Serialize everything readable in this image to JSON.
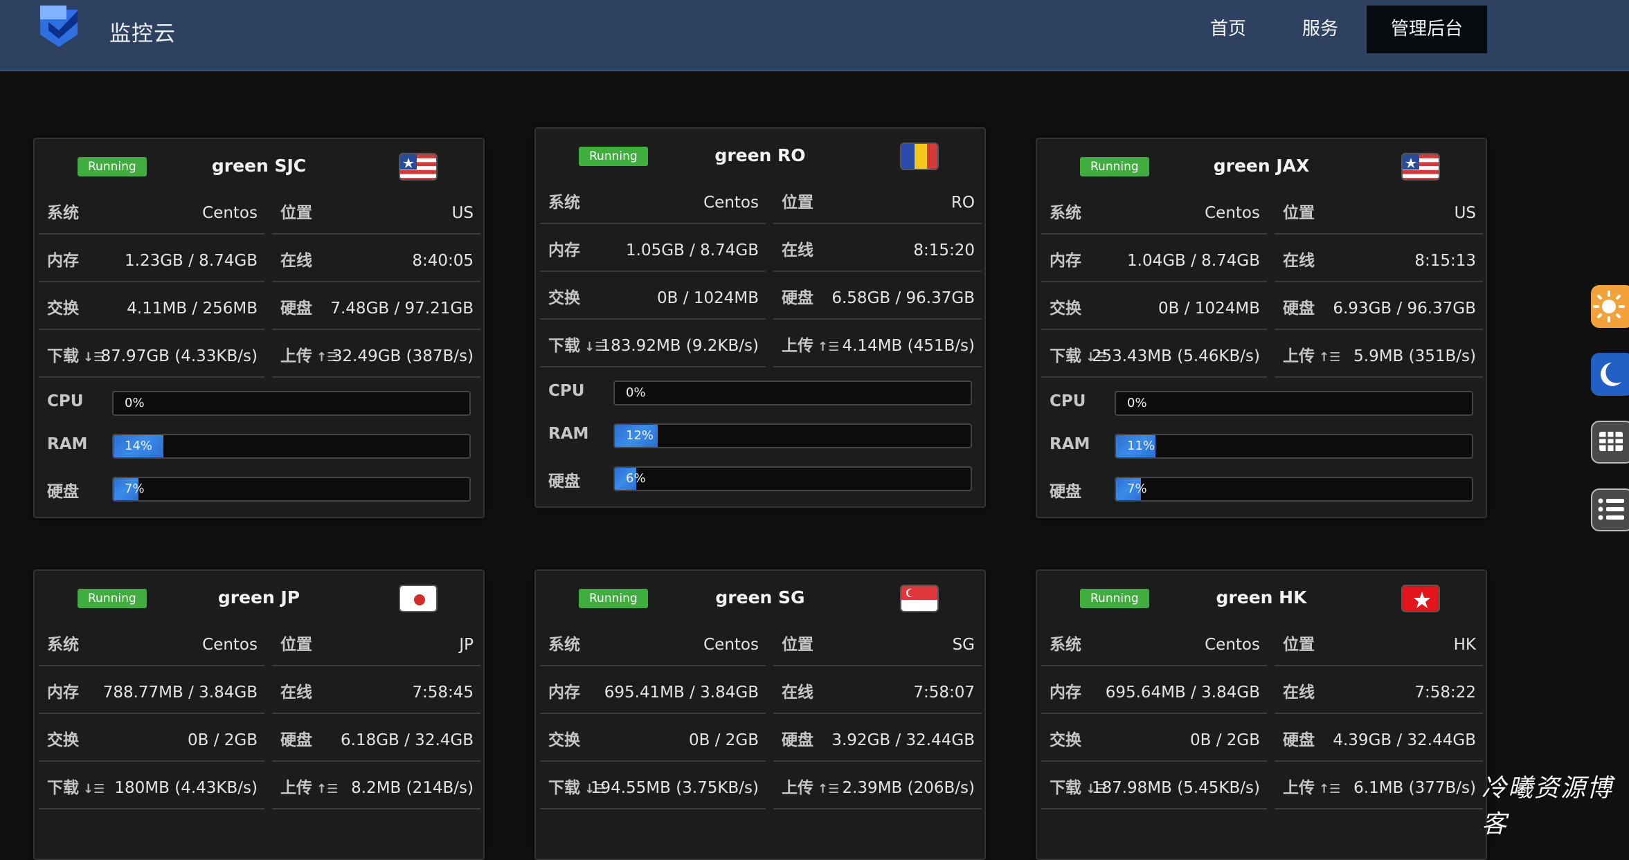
{
  "brand": {
    "name": "监控云",
    "logo_icon": "shield-logo-icon"
  },
  "nav": {
    "home": "首页",
    "services": "服务",
    "admin": "管理后台"
  },
  "labels": {
    "os": "系统",
    "location": "位置",
    "memory": "内存",
    "online": "在线",
    "swap": "交换",
    "disk": "硬盘",
    "download": "下载",
    "upload": "上传",
    "cpu": "CPU",
    "ram": "RAM",
    "disk_bar": "硬盘"
  },
  "servers": [
    {
      "status": "Running",
      "name": "green SJC",
      "flag": "us-flag-icon",
      "os": "Centos",
      "location": "US",
      "memory": "1.23GB / 8.74GB",
      "uptime": "8:40:05",
      "swap": "4.11MB / 256MB",
      "disk": "7.48GB / 97.21GB",
      "download": "87.97GB (4.33KB/s)",
      "upload": "32.49GB (387B/s)",
      "cpu": "0%",
      "cpu_pct": 0,
      "ram": "14%",
      "ram_pct": 14,
      "diskp": "7%",
      "disk_pct": 7
    },
    {
      "status": "Running",
      "name": "green RO",
      "flag": "ro-flag-icon",
      "os": "Centos",
      "location": "RO",
      "memory": "1.05GB / 8.74GB",
      "uptime": "8:15:20",
      "swap": "0B / 1024MB",
      "disk": "6.58GB / 96.37GB",
      "download": "183.92MB (9.2KB/s)",
      "upload": "4.14MB (451B/s)",
      "cpu": "0%",
      "cpu_pct": 0,
      "ram": "12%",
      "ram_pct": 12,
      "diskp": "6%",
      "disk_pct": 6
    },
    {
      "status": "Running",
      "name": "green JAX",
      "flag": "us-flag-icon",
      "os": "Centos",
      "location": "US",
      "memory": "1.04GB / 8.74GB",
      "uptime": "8:15:13",
      "swap": "0B / 1024MB",
      "disk": "6.93GB / 96.37GB",
      "download": "253.43MB (5.46KB/s)",
      "upload": "5.9MB (351B/s)",
      "cpu": "0%",
      "cpu_pct": 0,
      "ram": "11%",
      "ram_pct": 11,
      "diskp": "7%",
      "disk_pct": 7
    },
    {
      "status": "Running",
      "name": "green JP",
      "flag": "jp-flag-icon",
      "os": "Centos",
      "location": "JP",
      "memory": "788.77MB / 3.84GB",
      "uptime": "7:58:45",
      "swap": "0B / 2GB",
      "disk": "6.18GB / 32.4GB",
      "download": "180MB (4.43KB/s)",
      "upload": "8.2MB (214B/s)"
    },
    {
      "status": "Running",
      "name": "green SG",
      "flag": "sg-flag-icon",
      "os": "Centos",
      "location": "SG",
      "memory": "695.41MB / 3.84GB",
      "uptime": "7:58:07",
      "swap": "0B / 2GB",
      "disk": "3.92GB / 32.44GB",
      "download": "194.55MB (3.75KB/s)",
      "upload": "2.39MB (206B/s)"
    },
    {
      "status": "Running",
      "name": "green HK",
      "flag": "hk-flag-icon",
      "os": "Centos",
      "location": "HK",
      "memory": "695.64MB / 3.84GB",
      "uptime": "7:58:22",
      "swap": "0B / 2GB",
      "disk": "4.39GB / 32.44GB",
      "download": "187.98MB (5.45KB/s)",
      "upload": "6.1MB (377B/s)"
    }
  ],
  "sidebar": {
    "light_theme": "sun-icon",
    "dark_theme": "moon-icon",
    "grid_view": "grid-icon",
    "list_view": "list-icon"
  },
  "watermark": "冷曦资源博客",
  "colors": {
    "header": "#2e4160",
    "running": "#3fae3f",
    "bar": "#2b6fd1",
    "background": "#101010"
  }
}
